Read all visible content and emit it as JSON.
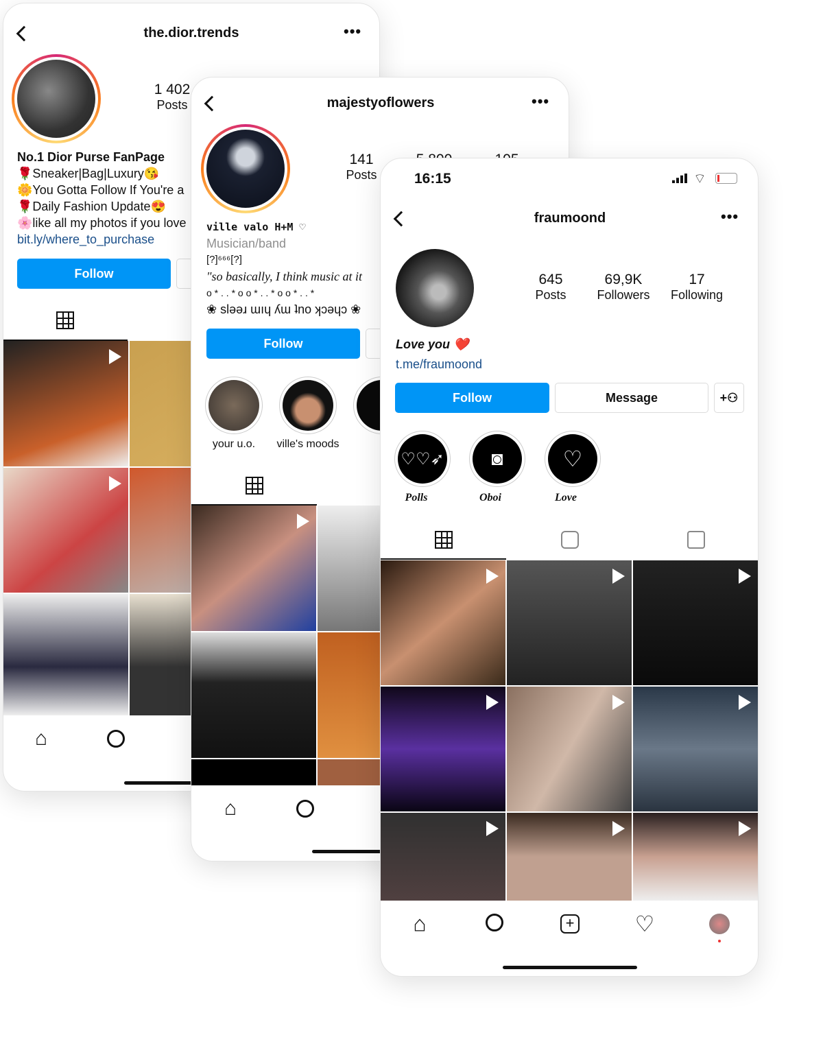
{
  "profile1": {
    "username": "the.dior.trends",
    "stats": [
      {
        "value": "1 402",
        "label": "Posts"
      }
    ],
    "bio_name": "No.1 Dior Purse FanPage",
    "bio_lines": [
      "🌹Sneaker|Bag|Luxury😘",
      "🌼You Gotta Follow If You're a",
      "🌹Daily Fashion Update😍",
      "🌸like all my photos if you love"
    ],
    "link": "bit.ly/where_to_purchase",
    "follow_label": "Follow"
  },
  "profile2": {
    "username": "majestyoflowers",
    "stats": [
      {
        "value": "141",
        "label": "Posts"
      },
      {
        "value": "5 800",
        "label": ""
      },
      {
        "value": "105",
        "label": ""
      }
    ],
    "bio_name": "ville valo H+M ♡",
    "category": "Musician/band",
    "bio_lines": [
      "[?]⁶⁶⁶[?]",
      "\"so basically, I think music at it",
      "o * . . * o o * . . * o o * . . *",
      "❀ sləəɹ ɯıɥ ʎɯ ʇno ʞɔəɥɔ ❀"
    ],
    "follow_label": "Follow",
    "highlights": [
      "your u.o.",
      "ville's moods",
      ""
    ]
  },
  "profile3": {
    "status_time": "16:15",
    "username": "fraumoond",
    "stats": [
      {
        "value": "645",
        "label": "Posts"
      },
      {
        "value": "69,9K",
        "label": "Followers"
      },
      {
        "value": "17",
        "label": "Following"
      }
    ],
    "bio_line": "Love you ❤️",
    "link": "t.me/fraumoond",
    "follow_label": "Follow",
    "message_label": "Message",
    "highlights": [
      "Polls",
      "Oboi",
      "Love"
    ],
    "battery_level": 0.1
  },
  "icons": [
    "back-icon",
    "more-icon",
    "grid-icon",
    "reels-icon",
    "tagged-icon",
    "play-icon",
    "home-icon",
    "search-icon",
    "add-icon",
    "heart-icon",
    "avatar-icon",
    "add-person-icon",
    "signal-icon",
    "wifi-icon",
    "battery-icon"
  ],
  "colors": {
    "accent": "#0095f6",
    "link": "#1a4f8a"
  }
}
